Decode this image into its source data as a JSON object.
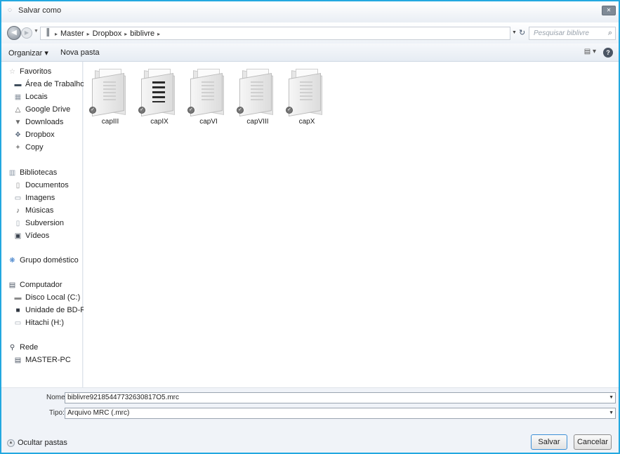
{
  "window": {
    "title": "Salvar como"
  },
  "address": {
    "crumbs": [
      "Master",
      "Dropbox",
      "biblivre"
    ],
    "search_placeholder": "Pesquisar biblivre"
  },
  "toolbar": {
    "organize_label": "Organizar ▾",
    "new_folder_label": "Nova pasta"
  },
  "sidebar": {
    "favorites_header": "Favoritos",
    "favorites": [
      "Área de Trabalho",
      "Locais",
      "Google Drive",
      "Downloads",
      "Dropbox",
      "Copy"
    ],
    "libraries_header": "Bibliotecas",
    "libraries": [
      "Documentos",
      "Imagens",
      "Músicas",
      "Subversion",
      "Vídeos"
    ],
    "homegroup": "Grupo doméstico",
    "computer_header": "Computador",
    "computer": [
      "Disco Local (C:)",
      "Unidade de BD-ROM",
      "Hitachi (H:)"
    ],
    "network_header": "Rede",
    "network": [
      "MASTER-PC"
    ]
  },
  "folders": [
    "capIII",
    "capIX",
    "capVI",
    "capVIII",
    "capX"
  ],
  "save": {
    "name_label": "Nome:",
    "name_value": "biblivre92185447732630817O5.mrc",
    "type_label": "Tipo:",
    "type_value": "Arquivo MRC (.mrc)",
    "hide_folders": "Ocultar pastas",
    "save_button": "Salvar",
    "cancel_button": "Cancelar"
  }
}
